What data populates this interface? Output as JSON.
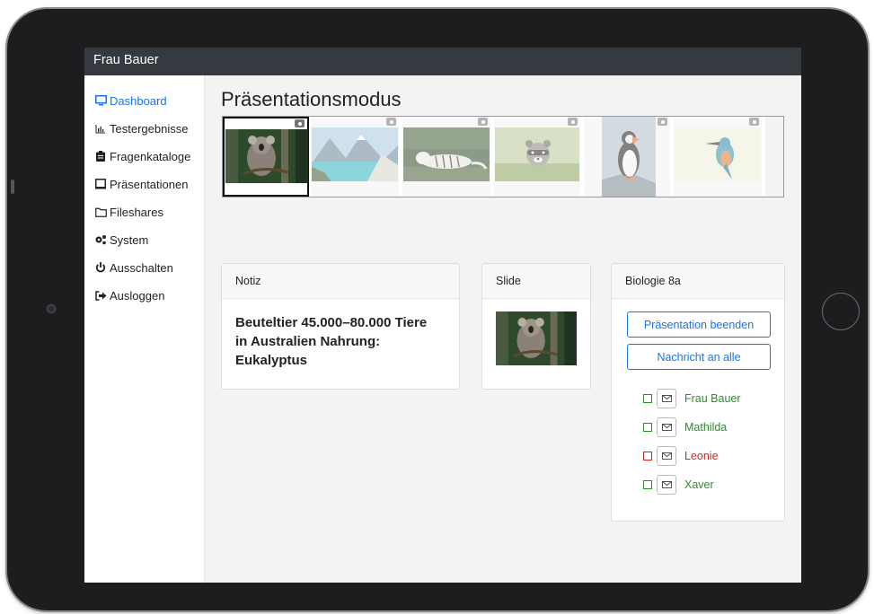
{
  "app": {
    "user_name": "Frau Bauer"
  },
  "sidebar": {
    "items": [
      {
        "label": "Dashboard",
        "icon": "monitor-icon",
        "active": true
      },
      {
        "label": "Testergebnisse",
        "icon": "bar-chart-icon"
      },
      {
        "label": "Fragenkataloge",
        "icon": "clipboard-icon"
      },
      {
        "label": "Präsentationen",
        "icon": "square-icon"
      },
      {
        "label": "Fileshares",
        "icon": "folder-icon"
      },
      {
        "label": "System",
        "icon": "gears-icon"
      },
      {
        "label": "Ausschalten",
        "icon": "power-icon"
      },
      {
        "label": "Ausloggen",
        "icon": "sign-out-icon"
      }
    ]
  },
  "page": {
    "title": "Präsentationsmodus"
  },
  "slides": [
    {
      "subject": "koala",
      "selected": true
    },
    {
      "subject": "mountain lake"
    },
    {
      "subject": "white tiger"
    },
    {
      "subject": "raccoon"
    },
    {
      "subject": "puffin"
    },
    {
      "subject": "kingfisher"
    }
  ],
  "note_card": {
    "header": "Notiz",
    "text": "Beuteltier 45.000–80.000 Tiere in Australien Nahrung: Eukalyptus"
  },
  "slide_card": {
    "header": "Slide"
  },
  "class_card": {
    "header": "Biologie 8a",
    "end_button": "Präsentation beenden",
    "message_all_button": "Nachricht an alle",
    "students": [
      {
        "name": "Frau Bauer",
        "status_color": "#2e8b2e"
      },
      {
        "name": "Mathilda",
        "status_color": "#2e8b2e"
      },
      {
        "name": "Leonie",
        "status_color": "#c62828"
      },
      {
        "name": "Xaver",
        "status_color": "#2e8b2e"
      }
    ]
  },
  "colors": {
    "accent": "#1a73e8",
    "topbar": "#343a40",
    "online": "#2e8b2e",
    "offline": "#c62828"
  }
}
